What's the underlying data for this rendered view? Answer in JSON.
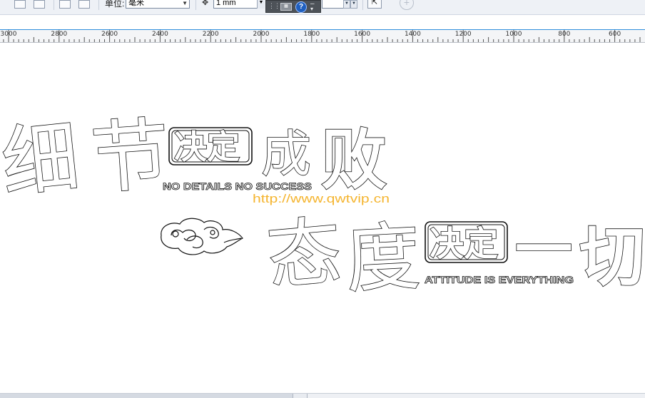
{
  "toolbar": {
    "unit_label": "单位:",
    "unit_value": "毫米",
    "nudge_value": "1 mm",
    "help_symbol": "?"
  },
  "ruler": {
    "labels": [
      "3000",
      "2800",
      "2600",
      "2400",
      "2200",
      "2000",
      "1800",
      "1600",
      "1400",
      "1200",
      "1000",
      "800",
      "600"
    ]
  },
  "artwork": {
    "char_xi": "细",
    "char_jie": "节",
    "box1_text": "决定",
    "char_cheng": "成",
    "char_bai": "败",
    "subtitle1": "NO DETAILS NO SUCCESS",
    "watermark": "http://www.qwtvip.cn",
    "char_tai": "态",
    "char_du": "度",
    "box2_text": "决定",
    "char_yi": "一",
    "char_qie": "切",
    "subtitle2": "ATTITUDE IS EVERYTHING"
  },
  "colors": {
    "accent_line": "#2f8fdc",
    "watermark": "#f5b530"
  }
}
